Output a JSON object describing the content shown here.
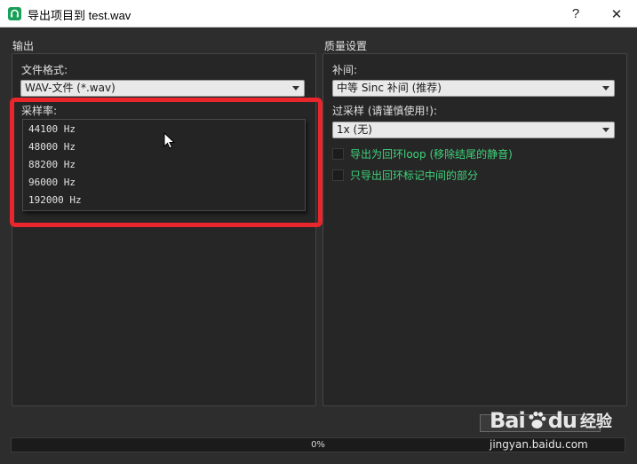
{
  "window": {
    "title": "导出项目到 test.wav",
    "help_label": "?",
    "close_label": "✕",
    "app_icon": "app-logo-icon"
  },
  "output": {
    "section_title": "输出",
    "file_format_label": "文件格式:",
    "file_format_value": "WAV-文件 (*.wav)",
    "sample_rate_label": "采样率:",
    "sample_rate_options": [
      "44100 Hz",
      "48000 Hz",
      "88200 Hz",
      "96000 Hz",
      "192000 Hz"
    ]
  },
  "quality": {
    "section_title": "质量设置",
    "interpolation_label": "补间:",
    "interpolation_value": "中等 Sinc 补间 (推荐)",
    "oversampling_label": "过采样 (请谨慎使用!):",
    "oversampling_value": "1x (无)",
    "checkbox_loop_label": "导出为回环loop (移除结尾的静音)",
    "checkbox_loop_checked": false,
    "checkbox_marks_label": "只导出回环标记中间的部分",
    "checkbox_marks_checked": false
  },
  "progress": {
    "text": "0%",
    "value": 0
  },
  "watermark": {
    "brand_a": "Bai",
    "brand_b": "du",
    "brand_cn": "经验",
    "url": "jingyan.baidu.com"
  },
  "colors": {
    "highlight_border": "#e8262b",
    "checkbox_label": "#3fd27a",
    "app_icon": "#18a058"
  }
}
